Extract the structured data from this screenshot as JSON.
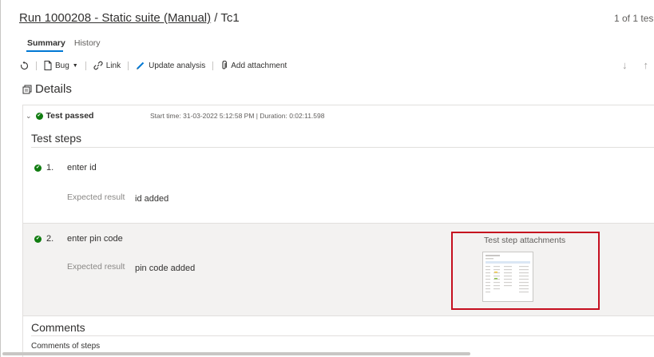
{
  "header": {
    "title_link": "Run 1000208 - Static suite (Manual)",
    "title_separator": " / ",
    "title_tail": "Tc1",
    "page_count": "1 of 1 tes"
  },
  "tabs": [
    {
      "label": "Summary",
      "active": true
    },
    {
      "label": "History",
      "active": false
    }
  ],
  "toolbar": {
    "refresh_icon": "refresh-icon",
    "bug_label": "Bug",
    "link_label": "Link",
    "update_analysis_label": "Update analysis",
    "add_attachment_label": "Add attachment"
  },
  "details": {
    "title": "Details"
  },
  "result": {
    "status": "Test passed",
    "start_info": "Start time: 31-03-2022 5:12:58 PM | Duration: 0:02:11.598",
    "status_color": "#107c10"
  },
  "steps_section": {
    "title": "Test steps",
    "expected_label": "Expected result",
    "steps": [
      {
        "number": "1.",
        "action": "enter id",
        "expected": "id added"
      },
      {
        "number": "2.",
        "action": "enter pin code",
        "expected": "pin code added"
      }
    ],
    "attachments_title": "Test step attachments",
    "highlight_color": "#c50f1f"
  },
  "comments": {
    "title": "Comments",
    "subtitle": "Comments of steps"
  }
}
